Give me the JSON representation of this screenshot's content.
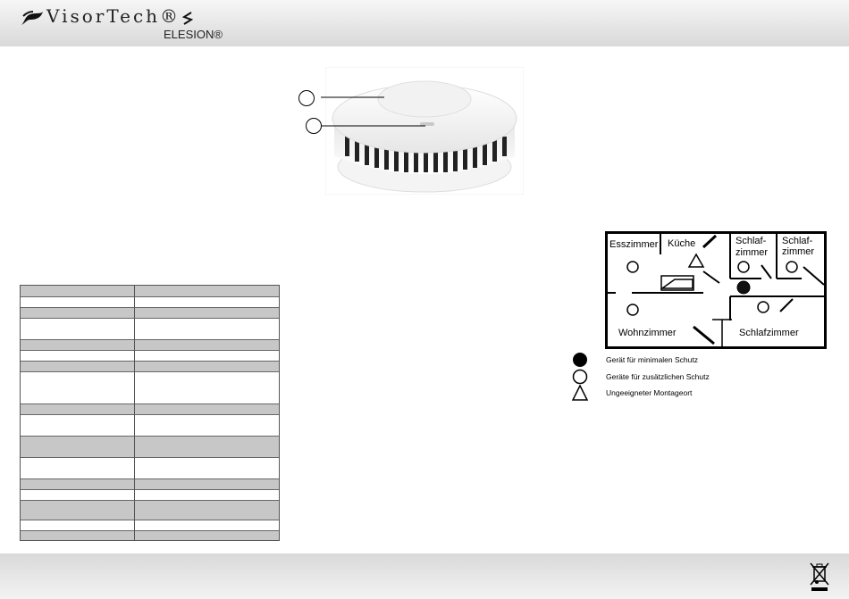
{
  "header": {
    "brand": "VisorTech®",
    "subbrand": "ELESION®",
    "icons": [
      "visortech-logo-icon",
      "elesion-logo-icon"
    ]
  },
  "figure": {
    "callouts": [
      "",
      ""
    ]
  },
  "floor_plan": {
    "rooms": {
      "esszimmer": "Esszimmer",
      "kueche": "Küche",
      "schlafzimmer_1_a": "Schlaf-",
      "schlafzimmer_1_b": "zimmer",
      "schlafzimmer_2_a": "Schlaf-",
      "schlafzimmer_2_b": "zimmer",
      "wohnzimmer": "Wohnzimmer",
      "schlafzimmer_3": "Schlafzimmer"
    }
  },
  "legend": {
    "items": [
      {
        "icon": "filled-circle-icon",
        "label": "Gerät für minimalen Schutz"
      },
      {
        "icon": "empty-circle-icon",
        "label": "Geräte für zusätzlichen Schutz"
      },
      {
        "icon": "triangle-icon",
        "label": "Ungeeigneter Montageort"
      }
    ]
  },
  "footer": {
    "icons": [
      "weee-crossed-bin-icon"
    ]
  },
  "colors": {
    "header_band": "#e0e0e0",
    "table_shade": "#c7c7c7"
  }
}
